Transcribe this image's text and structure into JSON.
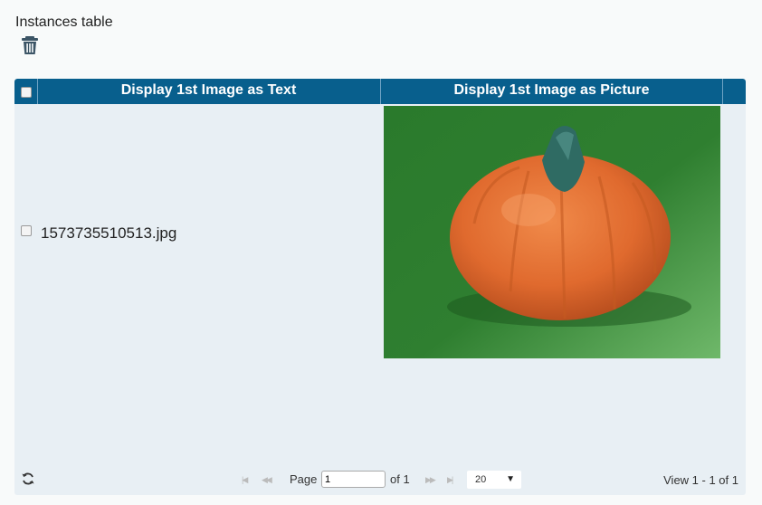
{
  "title": "Instances table",
  "icons": {
    "delete": "trash-icon",
    "refresh": "refresh-icon"
  },
  "grid": {
    "columns": [
      "Display 1st Image as Text",
      "Display 1st Image as Picture"
    ],
    "rows": [
      {
        "filename": "1573735510513.jpg",
        "image_subject": "pumpkin-photo"
      }
    ]
  },
  "pager": {
    "page_label": "Page",
    "page_value": "1",
    "of_label": "of 1",
    "page_size": "20",
    "view_text": "View 1 - 1 of 1"
  },
  "colors": {
    "header_bg": "#085f8d",
    "grid_bg": "#e8eff4"
  }
}
